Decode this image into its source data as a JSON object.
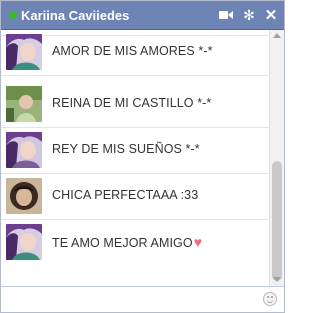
{
  "header": {
    "title": "Kariina Caviiedes",
    "status_color": "#42b72a",
    "bar_color": "#6d84b4",
    "icons": [
      "video-camera-icon",
      "gear-icon",
      "close-icon"
    ]
  },
  "messages": [
    {
      "text": "AMOR DE MIS AMORES *-*",
      "avatar": "avatar-purple-hair"
    },
    {
      "text": "REINA DE MI CASTILLO *-*",
      "avatar": "avatar-green-scene"
    },
    {
      "text": "REY DE MIS SUEÑOS *-*",
      "avatar": "avatar-purple-hair"
    },
    {
      "text": "CHICA PERFECTAAA :33",
      "avatar": "avatar-dark-portrait"
    },
    {
      "text": "TE AMO MEJOR AMIGO",
      "avatar": "avatar-purple-hair",
      "emoji": "heart"
    }
  ],
  "composer": {
    "placeholder": "",
    "emoji_icon": "smiley-icon"
  }
}
